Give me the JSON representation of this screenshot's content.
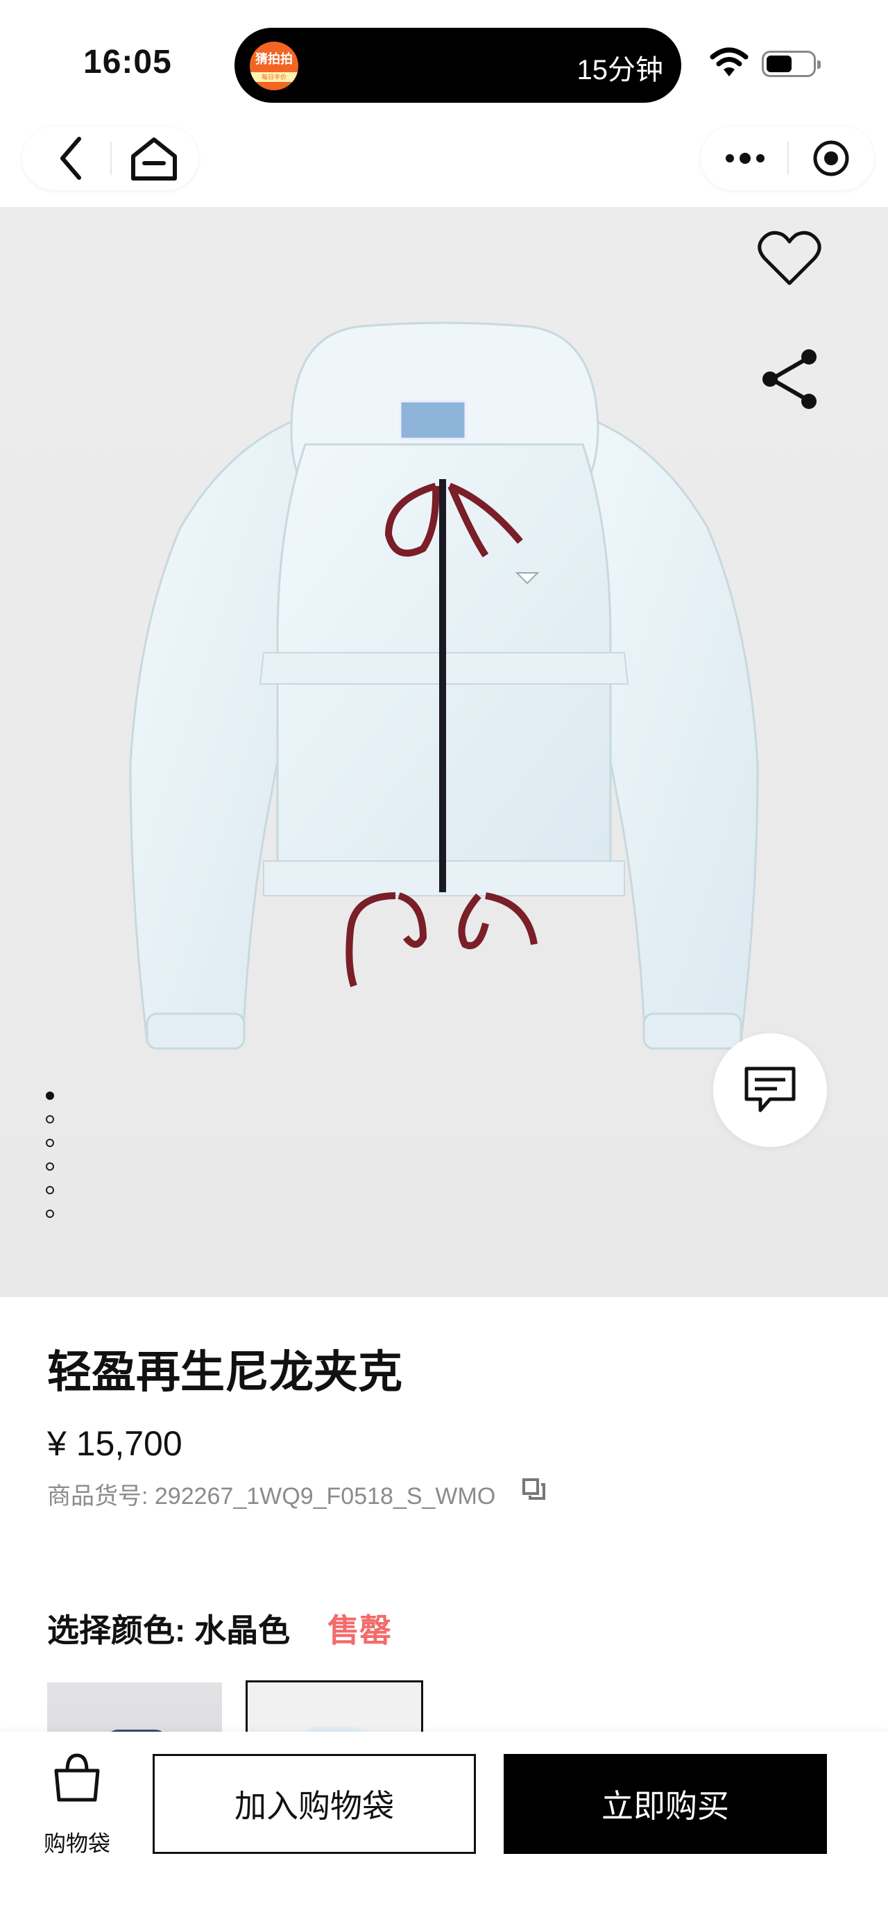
{
  "status_bar": {
    "time": "16:05",
    "island_text": "15分钟",
    "island_logo_top": "猜拍拍",
    "island_logo_bottom": "每日半价"
  },
  "nav": {
    "back_icon": "back-icon",
    "home_icon": "home-icon",
    "more_icon": "more-icon",
    "close_icon": "target-icon"
  },
  "product": {
    "title": "轻盈再生尼龙夹克",
    "price": "¥ 15,700",
    "sku": "商品货号: 292267_1WQ9_F0518_S_WMO",
    "color_label": "选择颜色: 水晶色",
    "status": "售罄",
    "carousel_total": 6,
    "carousel_active": 0
  },
  "bottom": {
    "bag_label": "购物袋",
    "add_label": "加入购物袋",
    "buy_label": "立即购买"
  }
}
